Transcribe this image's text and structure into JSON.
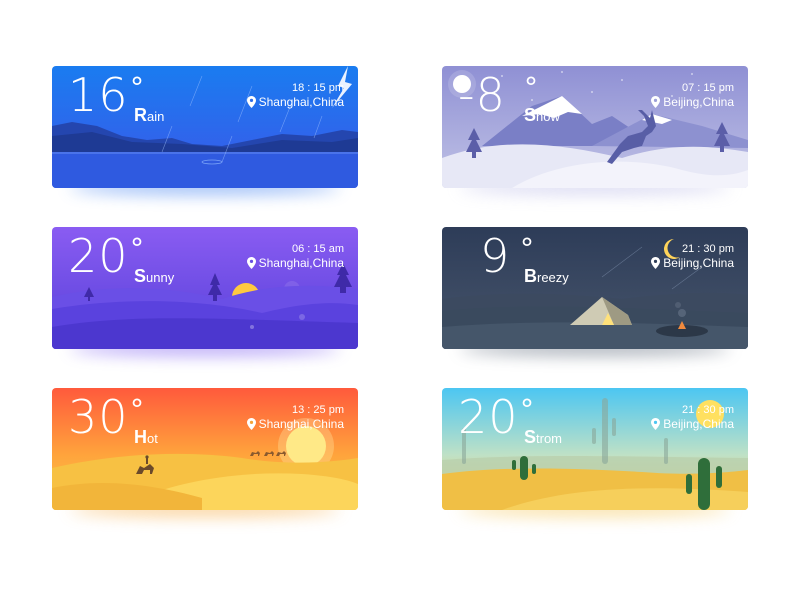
{
  "cards": [
    {
      "temp": "16",
      "deg": "°",
      "cond_first": "R",
      "cond_rest": "ain",
      "time": "18 : 15 pm",
      "location": "Shanghai,China"
    },
    {
      "temp": "-8",
      "deg": "°",
      "cond_first": "S",
      "cond_rest": "now",
      "time": "07 : 15 pm",
      "location": "Beijing,China"
    },
    {
      "temp": "20",
      "deg": "°",
      "cond_first": "S",
      "cond_rest": "unny",
      "time": "06 : 15 am",
      "location": "Shanghai,China"
    },
    {
      "temp": "9",
      "deg": "°",
      "cond_first": "B",
      "cond_rest": "reezy",
      "time": "21 : 30 pm",
      "location": "Beijing,China"
    },
    {
      "temp": "30",
      "deg": "°",
      "cond_first": "H",
      "cond_rest": "ot",
      "time": "13 : 25 pm",
      "location": "Shanghai,China"
    },
    {
      "temp": "20",
      "deg": "°",
      "cond_first": "S",
      "cond_rest": "trom",
      "time": "21 : 30 pm",
      "location": "Beijing,China"
    }
  ],
  "icons": {
    "location": "location-pin-icon"
  },
  "colors": {
    "rain": "#2f6de8",
    "snow": "#9c9fd8",
    "sunny": "#6a4fe0",
    "breezy": "#2f3e58",
    "hot": "#f5a43a",
    "strom": "#f0c14a"
  }
}
